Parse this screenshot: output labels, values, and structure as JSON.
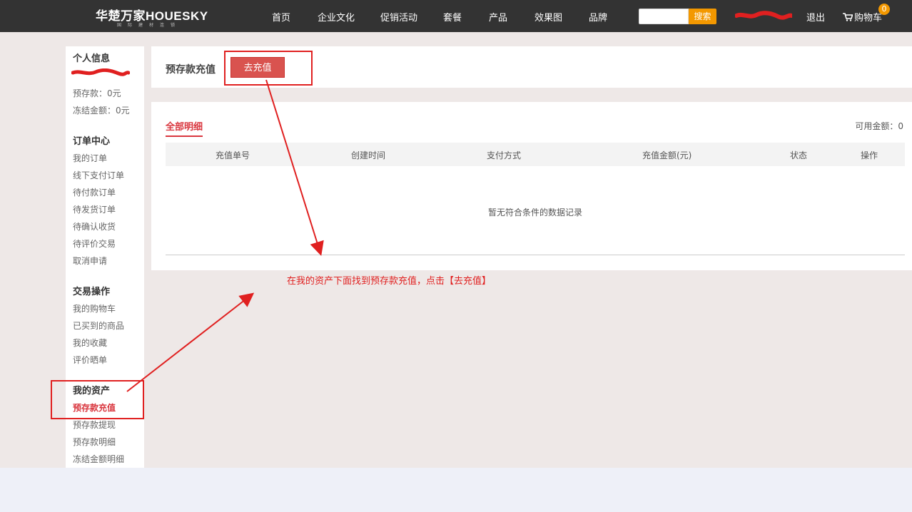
{
  "header": {
    "logo_main": "华楚万家HOUESKY",
    "logo_sub": "国际建材连锁",
    "nav": [
      "首页",
      "企业文化",
      "促销活动",
      "套餐",
      "产品",
      "效果图",
      "品牌"
    ],
    "search_button": "搜索",
    "search_placeholder": "",
    "logout": "退出",
    "cart_label": "购物车",
    "cart_count": "0"
  },
  "sidebar": {
    "personal": {
      "title": "个人信息",
      "deposit": "预存款：0元",
      "frozen": "冻结金额：0元"
    },
    "orders": {
      "title": "订单中心",
      "items": [
        "我的订单",
        "线下支付订单",
        "待付款订单",
        "待发货订单",
        "待确认收货",
        "待评价交易",
        "取消申请"
      ]
    },
    "trade": {
      "title": "交易操作",
      "items": [
        "我的购物车",
        "已买到的商品",
        "我的收藏",
        "评价晒单"
      ]
    },
    "assets": {
      "title": "我的资产",
      "items": [
        "预存款充值",
        "预存款提现",
        "预存款明细",
        "冻结金额明细"
      ]
    }
  },
  "main": {
    "section_title": "预存款充值",
    "recharge_button": "去充值",
    "tab_all": "全部明细",
    "available": "可用金额：0",
    "columns": [
      "充值单号",
      "创建时间",
      "支付方式",
      "充值金额(元)",
      "状态",
      "操作"
    ],
    "empty_text": "暂无符合条件的数据记录"
  },
  "annotation": {
    "text": "在我的资产下面找到预存款充值，点击【去充值】",
    "color": "#e02020"
  },
  "colors": {
    "accent_red": "#d9363e",
    "button_red": "#d9534f",
    "search_orange": "#f39800",
    "topbar": "#333333"
  }
}
